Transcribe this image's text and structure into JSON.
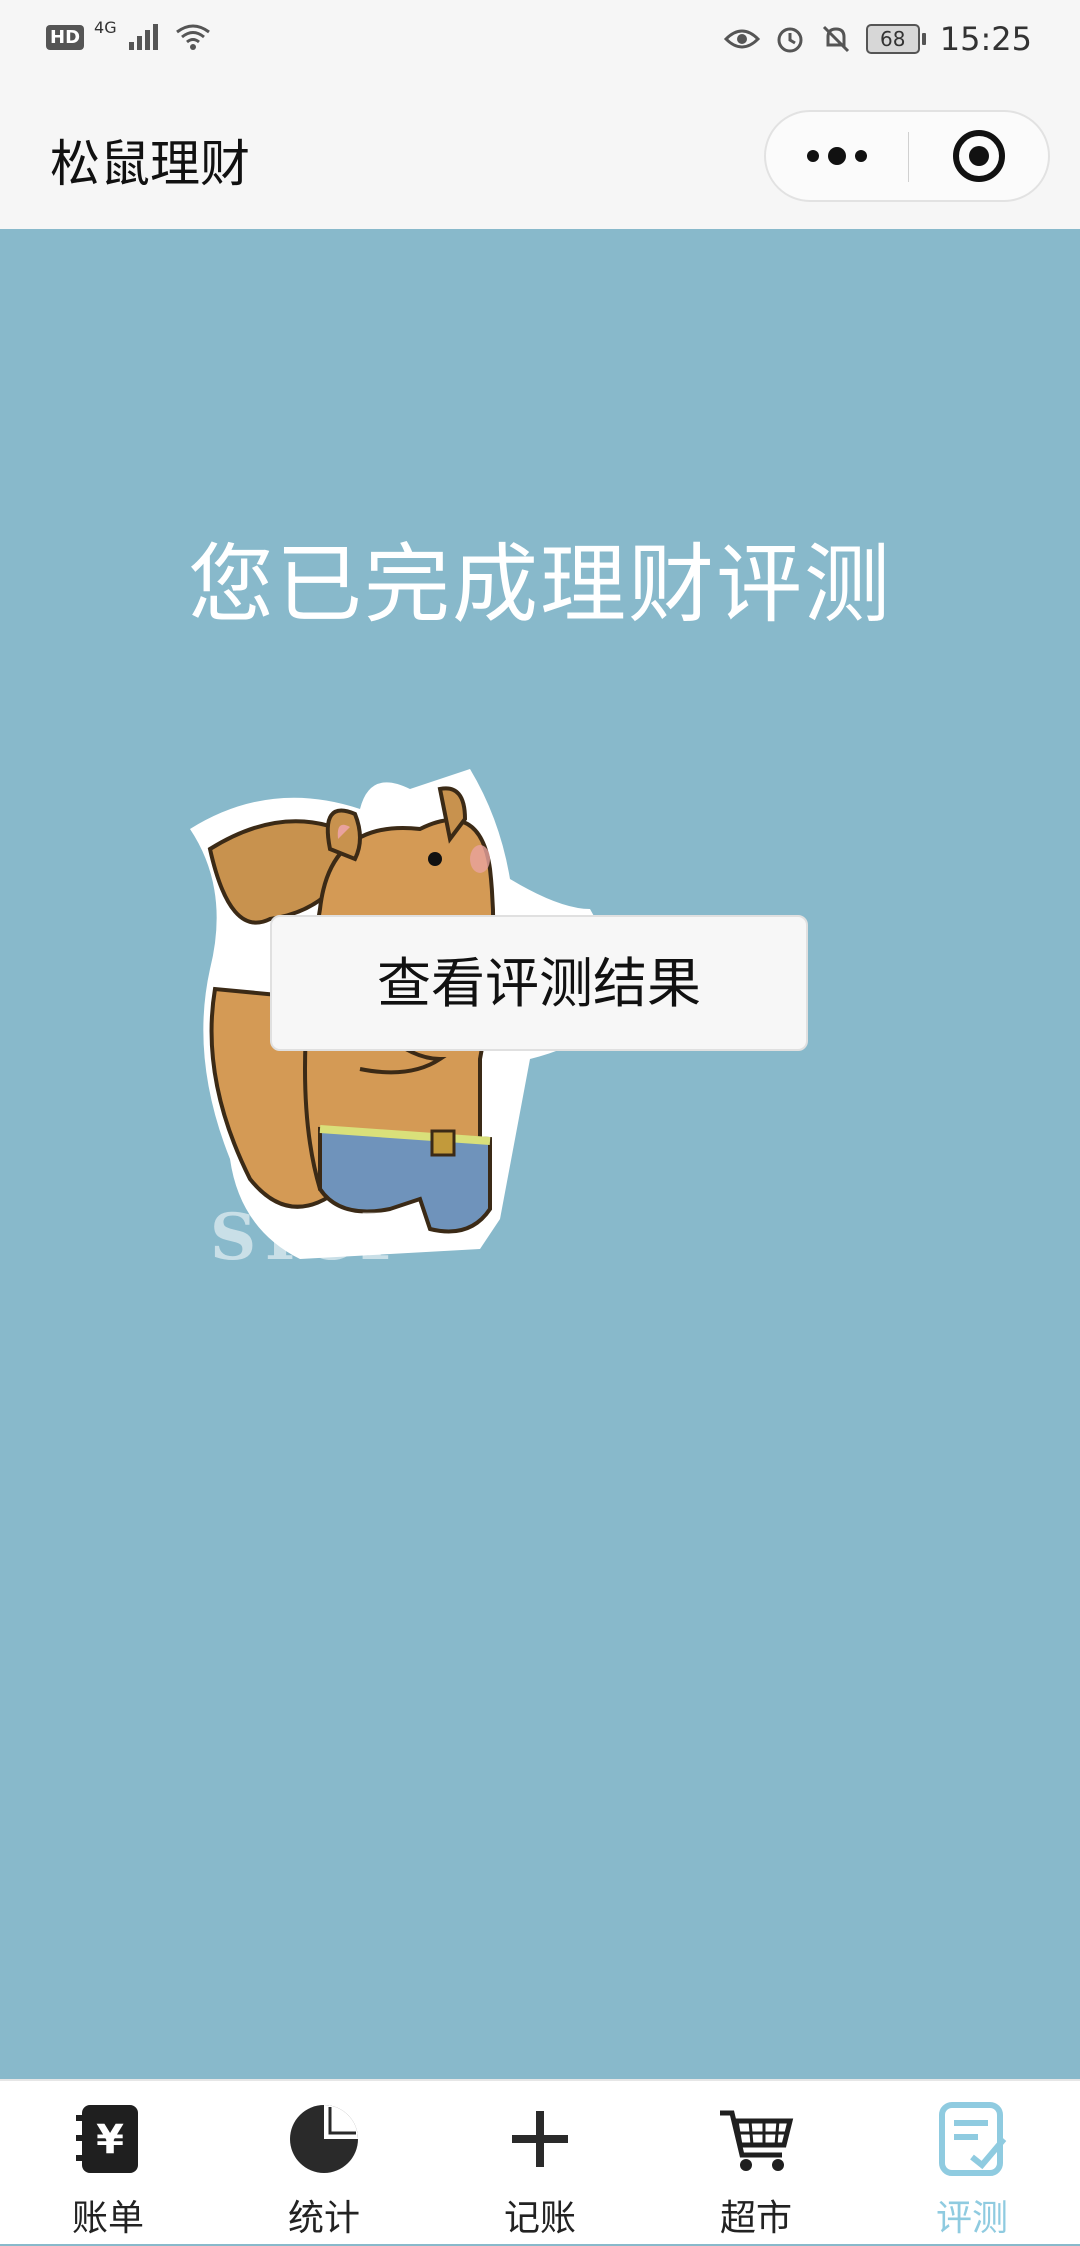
{
  "status_bar": {
    "left": {
      "hd": "HD",
      "network": "4G"
    },
    "battery": "68",
    "time": "15:25"
  },
  "nav": {
    "title": "松鼠理财",
    "capsule": {
      "more_icon": "more-dots-icon",
      "close_icon": "target-circle-icon"
    }
  },
  "main": {
    "headline": "您已完成理财评测",
    "result_button": "查看评测结果",
    "illustration": "squirrel-illustration"
  },
  "tabbar": {
    "items": [
      {
        "label": "账单",
        "icon": "ledger-icon",
        "active": false
      },
      {
        "label": "统计",
        "icon": "pie-chart-icon",
        "active": false
      },
      {
        "label": "记账",
        "icon": "plus-icon",
        "active": false
      },
      {
        "label": "超市",
        "icon": "shopping-cart-icon",
        "active": false
      },
      {
        "label": "评测",
        "icon": "assessment-icon",
        "active": true
      }
    ],
    "active_color": "#8fcbe0"
  },
  "colors": {
    "background": "#88b9cb",
    "nav_background": "#f6f6f6"
  }
}
